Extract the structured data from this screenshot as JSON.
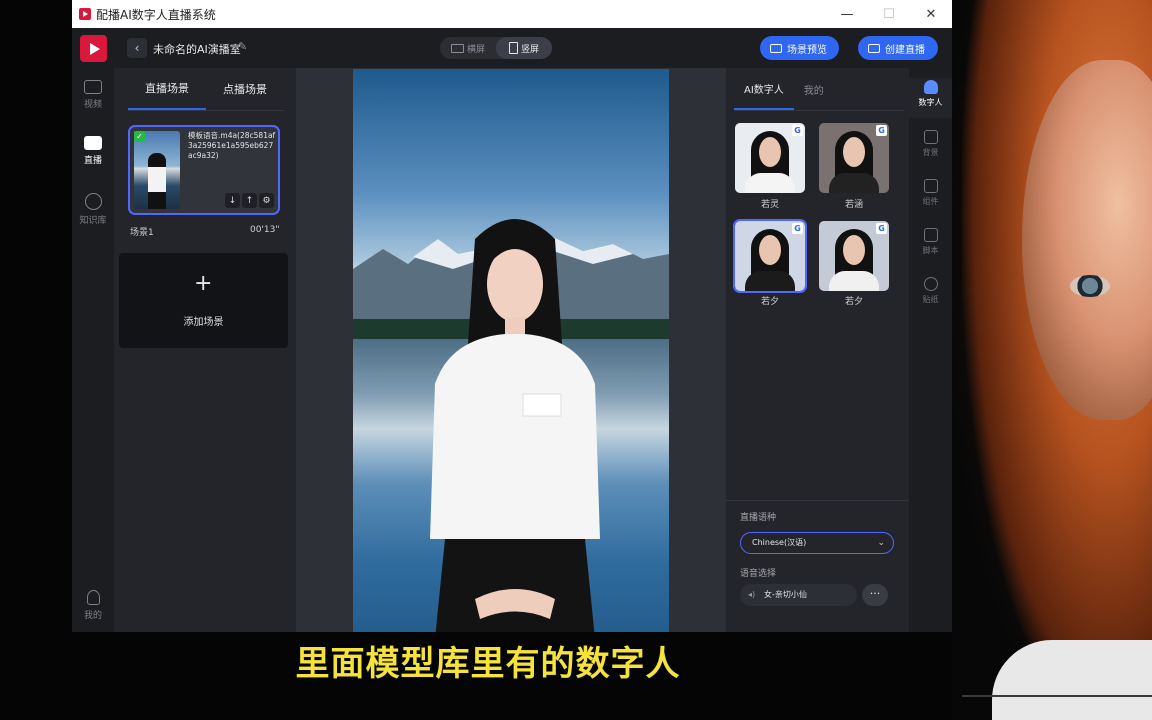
{
  "window": {
    "title": "配播AI数字人直播系统",
    "controls": [
      "—",
      "☐",
      "✕"
    ]
  },
  "header": {
    "room_name": "未命名的AI演播室",
    "orientation": {
      "landscape": "横屏",
      "portrait": "竖屏",
      "active": "portrait"
    },
    "preview_button": "场景预览",
    "create_button": "创建直播"
  },
  "rail": {
    "items": [
      {
        "label": "视频",
        "icon": "video-icon"
      },
      {
        "label": "直播",
        "icon": "live-icon",
        "active": true
      },
      {
        "label": "知识库",
        "icon": "knowledge-icon"
      },
      {
        "label": "我的",
        "icon": "user-icon"
      }
    ]
  },
  "scenes": {
    "tabs": [
      "直播场景",
      "点播场景"
    ],
    "active_tab": 0,
    "card": {
      "text": "模板语音.m4a(28c581af3a25961e1a595eb627ac9a32)",
      "name": "场景1",
      "duration": "00'13\""
    },
    "add_label": "添加场景"
  },
  "avatars": {
    "tabs": [
      "AI数字人",
      "我的"
    ],
    "items": [
      {
        "name": "若灵",
        "badge": "G",
        "bg": "#e9edf2",
        "top": "#f4f4f4"
      },
      {
        "name": "若涵",
        "badge": "G",
        "bg": "#7a7270",
        "top": "#222222"
      },
      {
        "name": "若夕",
        "badge": "G",
        "bg": "#cfd6e6",
        "top": "#1b1b1b",
        "selected": true
      },
      {
        "name": "若夕",
        "badge": "G",
        "bg": "#c4cbd6",
        "top": "#f0f0f0"
      }
    ],
    "language_label": "直播语种",
    "language_value": "Chinese(汉语)",
    "voice_label": "语音选择",
    "voice_value": "女-亲切小仙",
    "more_label": "···"
  },
  "tools": {
    "items": [
      {
        "label": "数字人",
        "active": true
      },
      {
        "label": "背景"
      },
      {
        "label": "组件"
      },
      {
        "label": "脚本"
      },
      {
        "label": "贴纸"
      }
    ]
  },
  "subtitle": "里面模型库里有的数字人",
  "colors": {
    "accent": "#2f66f2",
    "brand": "#d9183b",
    "subtitle": "#f5e33b"
  }
}
